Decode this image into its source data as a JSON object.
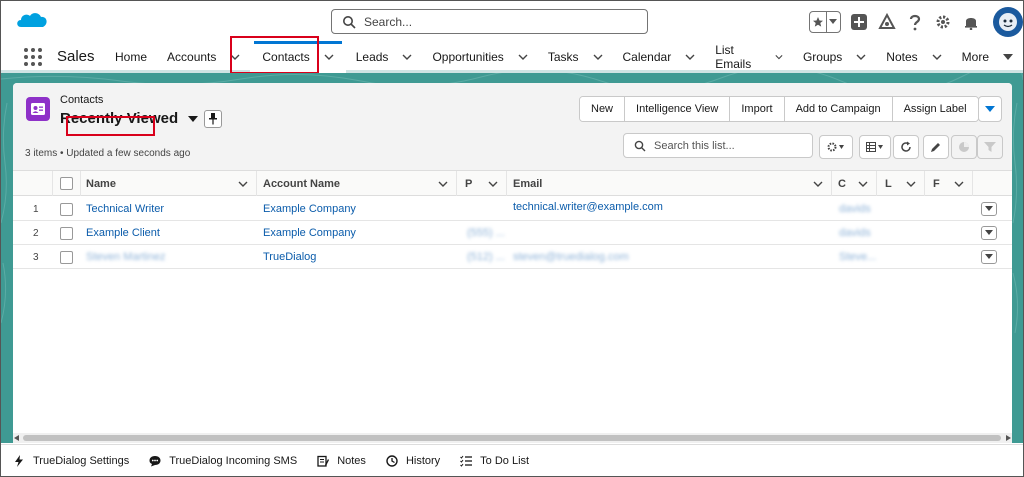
{
  "header": {
    "search_placeholder": "Search..."
  },
  "nav": {
    "app_name": "Sales",
    "items": [
      {
        "label": "Home",
        "dropdown": false
      },
      {
        "label": "Accounts",
        "dropdown": true
      },
      {
        "label": "Contacts",
        "dropdown": true,
        "active": true
      },
      {
        "label": "Leads",
        "dropdown": true
      },
      {
        "label": "Opportunities",
        "dropdown": true
      },
      {
        "label": "Tasks",
        "dropdown": true
      },
      {
        "label": "Calendar",
        "dropdown": true
      },
      {
        "label": "List Emails",
        "dropdown": true
      },
      {
        "label": "Groups",
        "dropdown": true
      },
      {
        "label": "Notes",
        "dropdown": true
      },
      {
        "label": "More",
        "dropdown": true
      }
    ]
  },
  "list": {
    "object_label": "Contacts",
    "title": "Recently Viewed",
    "meta": "3 items • Updated a few seconds ago",
    "buttons": [
      "New",
      "Intelligence View",
      "Import",
      "Add to Campaign",
      "Assign Label"
    ],
    "search_placeholder": "Search this list..."
  },
  "table": {
    "columns": {
      "name": "Name",
      "account": "Account Name",
      "phone": "P",
      "email": "Email",
      "col_c": "C",
      "col_l": "L",
      "col_f": "F"
    },
    "rows": [
      {
        "num": "1",
        "name": "Technical Writer",
        "name_blurred": false,
        "account": "Example Company",
        "phone": "",
        "email": "technical.writer@example.com",
        "email_blurred": false,
        "owner": "davids"
      },
      {
        "num": "2",
        "name": "Example Client",
        "name_blurred": false,
        "account": "Example Company",
        "phone": "(555) ...",
        "email": "",
        "email_blurred": false,
        "owner": "davids"
      },
      {
        "num": "3",
        "name": "Steven Martinez",
        "name_blurred": true,
        "account": "TrueDialog",
        "phone": "(512) ...",
        "email": "steven@truedialog.com",
        "email_blurred": true,
        "owner": "Steve..."
      }
    ]
  },
  "utility_bar": {
    "items": [
      {
        "label": "TrueDialog Settings",
        "icon": "bolt-icon"
      },
      {
        "label": "TrueDialog Incoming SMS",
        "icon": "chat-icon"
      },
      {
        "label": "Notes",
        "icon": "note-icon"
      },
      {
        "label": "History",
        "icon": "clock-icon"
      },
      {
        "label": "To Do List",
        "icon": "checklist-icon"
      }
    ]
  },
  "colors": {
    "brand_blue": "#0176d3",
    "link": "#0b5cab",
    "highlight_red": "#d9001b",
    "band_teal": "#3f9a93",
    "contact_icon": "#8e31c8"
  }
}
